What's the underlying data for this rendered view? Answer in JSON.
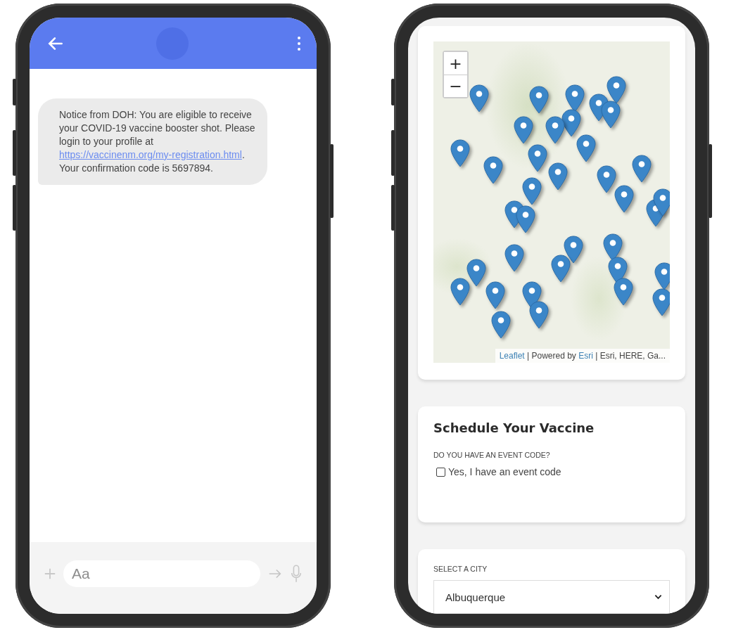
{
  "messaging_screen": {
    "message": {
      "text_before": "Notice from DOH: You are eligible to receive your COVID-19 vaccine booster shot. Please login to your profile at ",
      "link": "https://vaccinenm.org/my-registration.html",
      "text_after": ". Your confirmation code is 5697894."
    },
    "composer": {
      "placeholder": "Aa"
    }
  },
  "scheduling_screen": {
    "map": {
      "zoom_in": "+",
      "zoom_out": "−",
      "attribution": [
        {
          "text": "Leaflet",
          "link": true
        },
        {
          "text": " | Powered by ",
          "link": false
        },
        {
          "text": "Esri",
          "link": true
        },
        {
          "text": " | Esri, HERE, Ga...",
          "link": false
        }
      ]
    },
    "schedule": {
      "title": "Schedule Your Vaccine",
      "question": "DO YOU HAVE AN EVENT CODE?",
      "event_code_checkbox": {
        "label": "Yes, I have an event code",
        "checked": false
      }
    },
    "city": {
      "label": "SELECT A CITY",
      "value": "Albuquerque"
    }
  }
}
